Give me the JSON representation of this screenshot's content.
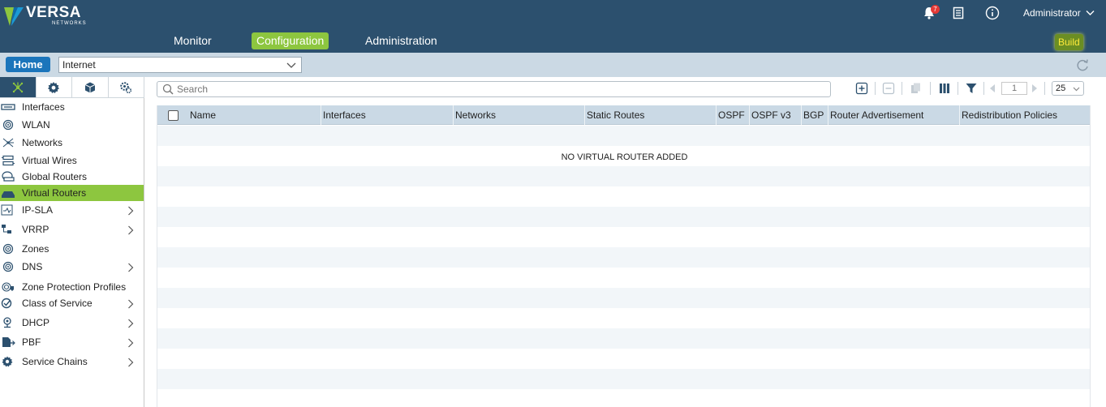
{
  "header": {
    "logo": {
      "main": "VERSA",
      "sub": "NETWORKS"
    },
    "nav": [
      {
        "label": "Monitor",
        "active": false
      },
      {
        "label": "Configuration",
        "active": true
      },
      {
        "label": "Administration",
        "active": false
      }
    ],
    "notifications_count": "7",
    "user": "Administrator",
    "build_label": "Build",
    "colors": {
      "bg": "#2c506e",
      "accent": "#8dc63f"
    }
  },
  "subbar": {
    "home_label": "Home",
    "context_value": "Internet"
  },
  "sidebar": {
    "tabs": [
      "networking-icon",
      "gear-icon",
      "cube-icon",
      "settings-cog-icon"
    ],
    "items": [
      {
        "label": "Interfaces",
        "icon": "interface-icon",
        "expandable": false,
        "selected": false
      },
      {
        "label": "WLAN",
        "icon": "wifi-icon",
        "expandable": false,
        "selected": false
      },
      {
        "label": "Networks",
        "icon": "network-icon",
        "expandable": false,
        "selected": false
      },
      {
        "label": "Virtual Wires",
        "icon": "wire-icon",
        "expandable": false,
        "selected": false
      },
      {
        "label": "Global Routers",
        "icon": "router-icon",
        "expandable": false,
        "selected": false
      },
      {
        "label": "Virtual Routers",
        "icon": "router-icon",
        "expandable": false,
        "selected": true
      },
      {
        "label": "IP-SLA",
        "icon": "sla-icon",
        "expandable": true,
        "selected": false
      },
      {
        "label": "VRRP",
        "icon": "vrrp-icon",
        "expandable": true,
        "selected": false
      },
      {
        "label": "Zones",
        "icon": "zone-icon",
        "expandable": false,
        "selected": false
      },
      {
        "label": "DNS",
        "icon": "dns-icon",
        "expandable": true,
        "selected": false
      },
      {
        "label": "Zone Protection Profiles",
        "icon": "zone-protection-icon",
        "expandable": false,
        "selected": false
      },
      {
        "label": "Class of Service",
        "icon": "cos-icon",
        "expandable": true,
        "selected": false
      },
      {
        "label": "DHCP",
        "icon": "dhcp-icon",
        "expandable": true,
        "selected": false
      },
      {
        "label": "PBF",
        "icon": "pbf-icon",
        "expandable": true,
        "selected": false
      },
      {
        "label": "Service Chains",
        "icon": "gear-icon",
        "expandable": true,
        "selected": false
      }
    ]
  },
  "main": {
    "search_placeholder": "Search",
    "page_number": "1",
    "page_size": "25",
    "columns": [
      "Name",
      "Interfaces",
      "Networks",
      "Static Routes",
      "OSPF",
      "OSPF v3",
      "BGP",
      "Router Advertisement",
      "Redistribution Policies"
    ],
    "empty_message": "NO VIRTUAL ROUTER ADDED"
  }
}
